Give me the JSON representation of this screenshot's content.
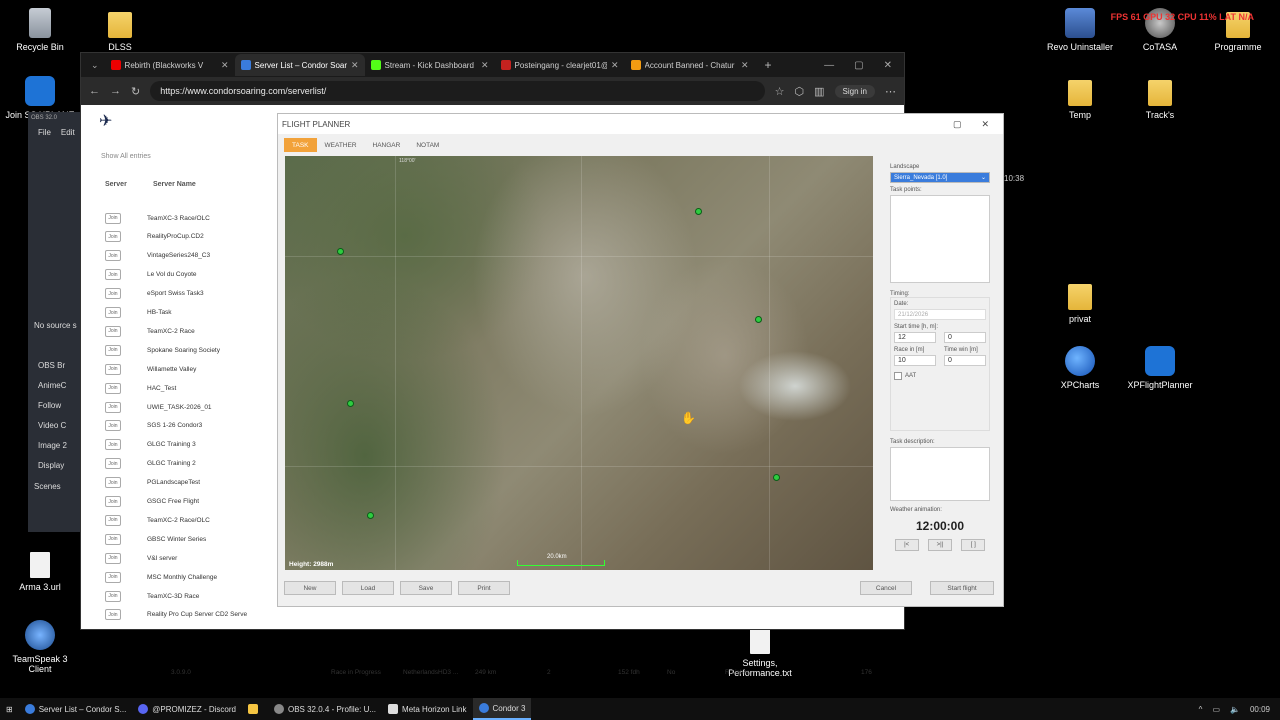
{
  "desktop": {
    "left_icons": [
      {
        "label": "Recycle Bin",
        "icon": "recycle-bin-icon"
      },
      {
        "label": "DLSS",
        "icon": "folder-icon"
      },
      {
        "label": "Join SS XPLANE",
        "icon": "plane-icon"
      },
      {
        "label": "Arma 3.url",
        "icon": "file-icon"
      },
      {
        "label": "TeamSpeak 3 Client",
        "icon": "teamspeak-icon"
      }
    ],
    "right_icons": [
      {
        "label": "Revo Uninstaller",
        "icon": "revo-icon"
      },
      {
        "label": "CoTASA",
        "icon": "cotasa-icon"
      },
      {
        "label": "Programme",
        "icon": "folder-icon"
      },
      {
        "label": "Temp",
        "icon": "folder-icon"
      },
      {
        "label": "Track's",
        "icon": "folder-icon"
      },
      {
        "label": "privat",
        "icon": "folder-icon"
      },
      {
        "label": "XPCharts",
        "icon": "globe-icon"
      },
      {
        "label": "XPFlightPlanner",
        "icon": "plane-icon"
      },
      {
        "label": "Settings, Performance.txt",
        "icon": "file-icon"
      }
    ],
    "overlay_stats": "FPS 61  GPU 32  CPU 11%  LAT N/A",
    "overlay_clock": "10:38"
  },
  "browser": {
    "tabs": [
      {
        "label": "Rebirth (Blackworks V",
        "color": "#e00"
      },
      {
        "label": "Server List – Condor Soar",
        "color": "#3a7cdc",
        "active": true
      },
      {
        "label": "Stream - Kick Dashboard",
        "color": "#53fc18"
      },
      {
        "label": "Posteingang - clearjet01@",
        "color": "#c5221f"
      },
      {
        "label": "Account Banned - Chatur",
        "color": "#f39c12"
      }
    ],
    "url": "https://www.condorsoaring.com/serverlist/",
    "signin": "Sign in"
  },
  "serverlist": {
    "show": "Show  All      entries",
    "headers": [
      "Server",
      "Server Name"
    ],
    "join_label": "Join",
    "rows": [
      "TeamXC-3 Race/OLC",
      "RealityProCup.CD2",
      "VintageSeries248_C3",
      "Le Vol du Coyote",
      "eSport Swiss Task3",
      "HB-Task",
      "TeamXC-2 Race",
      "Spokane Soaring Society",
      "Willamette Valley",
      "HAC_Test",
      "UWIE_TASK-2026_01",
      "SGS 1-26 Condor3",
      "GLGC Training 3",
      "GLGC Training 2",
      "PGLandscapeTest",
      "GSGC Free Flight",
      "TeamXC-2 Race/OLC",
      "GBSC Winter Series",
      "V&I server",
      "MSC Monthly Challenge",
      "TeamXC-3D Race",
      "Reality Pro Cup Server CD2 Serve"
    ],
    "bottom": [
      "3.0.9.0",
      "Race in Progress",
      "NetherlandsHD3 ...",
      "249 km",
      "2",
      "152 fdh",
      "No",
      "R.Lisher",
      "176"
    ]
  },
  "obs": {
    "title": "OBS 32.0",
    "menu": [
      "File",
      "Edit"
    ],
    "no_source": "No source s",
    "items": [
      "OBS Br",
      "AnimeC",
      "Follow",
      "Video C",
      "Image 2",
      "Display"
    ],
    "scenes": "Scenes"
  },
  "flightplanner": {
    "title": "FLIGHT PLANNER",
    "tabs": [
      "TASK",
      "WEATHER",
      "HANGAR",
      "NOTAM"
    ],
    "map_height": "Height: 2988m",
    "scale": "20.0km",
    "lon_label": "118°00'",
    "landscape_label": "Landscape",
    "landscape_value": "Sierra_Nevada [1.0]",
    "task_points": "Task points:",
    "timing": "Timing:",
    "date_label": "Date:",
    "date_value": "21/12/2026",
    "start_time_label": "Start time [h, m]:",
    "start_h": "12",
    "start_m": "0",
    "race_in_label": "Race in [m]",
    "time_win_label": "Time win [m]",
    "race_in": "10",
    "time_win": "0",
    "aat": "AAT",
    "task_description": "Task description:",
    "weather_animation": "Weather animation:",
    "anim_time": "12:00:00",
    "anim_buttons": [
      "|<",
      ">||",
      "[ ]"
    ],
    "buttons": {
      "new": "New",
      "load": "Load",
      "save": "Save",
      "print": "Print",
      "cancel": "Cancel",
      "start": "Start flight"
    }
  },
  "taskbar": {
    "items": [
      {
        "label": "Server List – Condor S...",
        "color": "#3a7cdc"
      },
      {
        "label": "@PROMIZEZ - Discord",
        "color": "#5865f2"
      },
      {
        "label": "",
        "color": "#f5c542"
      },
      {
        "label": "OBS 32.0.4 - Profile: U...",
        "color": "#888"
      },
      {
        "label": "Meta Horizon Link",
        "color": "#ddd"
      },
      {
        "label": "Condor 3",
        "color": "#3a7cdc",
        "active": true
      }
    ],
    "clock": "00:09"
  }
}
